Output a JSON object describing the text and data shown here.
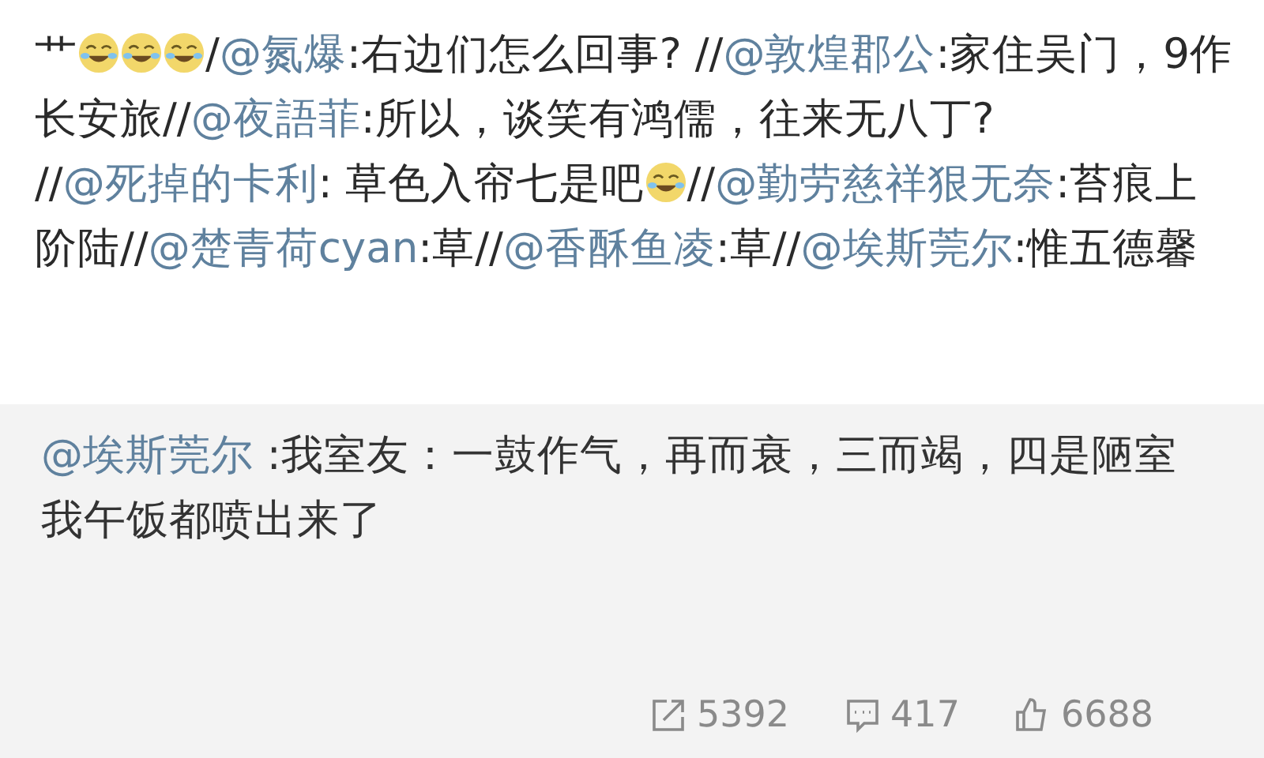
{
  "post": {
    "segments": [
      {
        "kind": "text",
        "text": "艹"
      },
      {
        "kind": "emoji"
      },
      {
        "kind": "emoji"
      },
      {
        "kind": "emoji"
      },
      {
        "kind": "text",
        "text": "/"
      },
      {
        "kind": "mention",
        "text": "@氮爆"
      },
      {
        "kind": "text",
        "text": ":右边们怎么回事? //"
      },
      {
        "kind": "mention",
        "text": "@敦煌郡公"
      },
      {
        "kind": "text",
        "text": ":家住吴门，9作长安旅//"
      },
      {
        "kind": "mention",
        "text": "@夜語菲"
      },
      {
        "kind": "text",
        "text": ":所以，谈笑有鸿儒，往来无八丁? //"
      },
      {
        "kind": "mention",
        "text": "@死掉的卡利"
      },
      {
        "kind": "text",
        "text": ": 草色入帘七是吧"
      },
      {
        "kind": "emoji"
      },
      {
        "kind": "text",
        "text": "//"
      },
      {
        "kind": "mention",
        "text": "@勤劳慈祥狠无奈"
      },
      {
        "kind": "text",
        "text": ":苔痕上阶陆//"
      },
      {
        "kind": "mention",
        "text": "@楚青荷cyan"
      },
      {
        "kind": "text",
        "text": ":草//"
      },
      {
        "kind": "mention",
        "text": "@香酥鱼凌"
      },
      {
        "kind": "text",
        "text": ":草//"
      },
      {
        "kind": "mention",
        "text": "@埃斯莞尔"
      },
      {
        "kind": "text",
        "text": ":惟五德馨"
      }
    ]
  },
  "repost": {
    "author": "@埃斯莞尔",
    "text": " :我室友：一鼓作气，再而衰，三而竭，四是陋室",
    "second_line": "我午饭都喷出来了"
  },
  "stats": [
    {
      "kind": "share",
      "count": "5392"
    },
    {
      "kind": "comment",
      "count": "417"
    },
    {
      "kind": "like",
      "count": "6688"
    }
  ]
}
